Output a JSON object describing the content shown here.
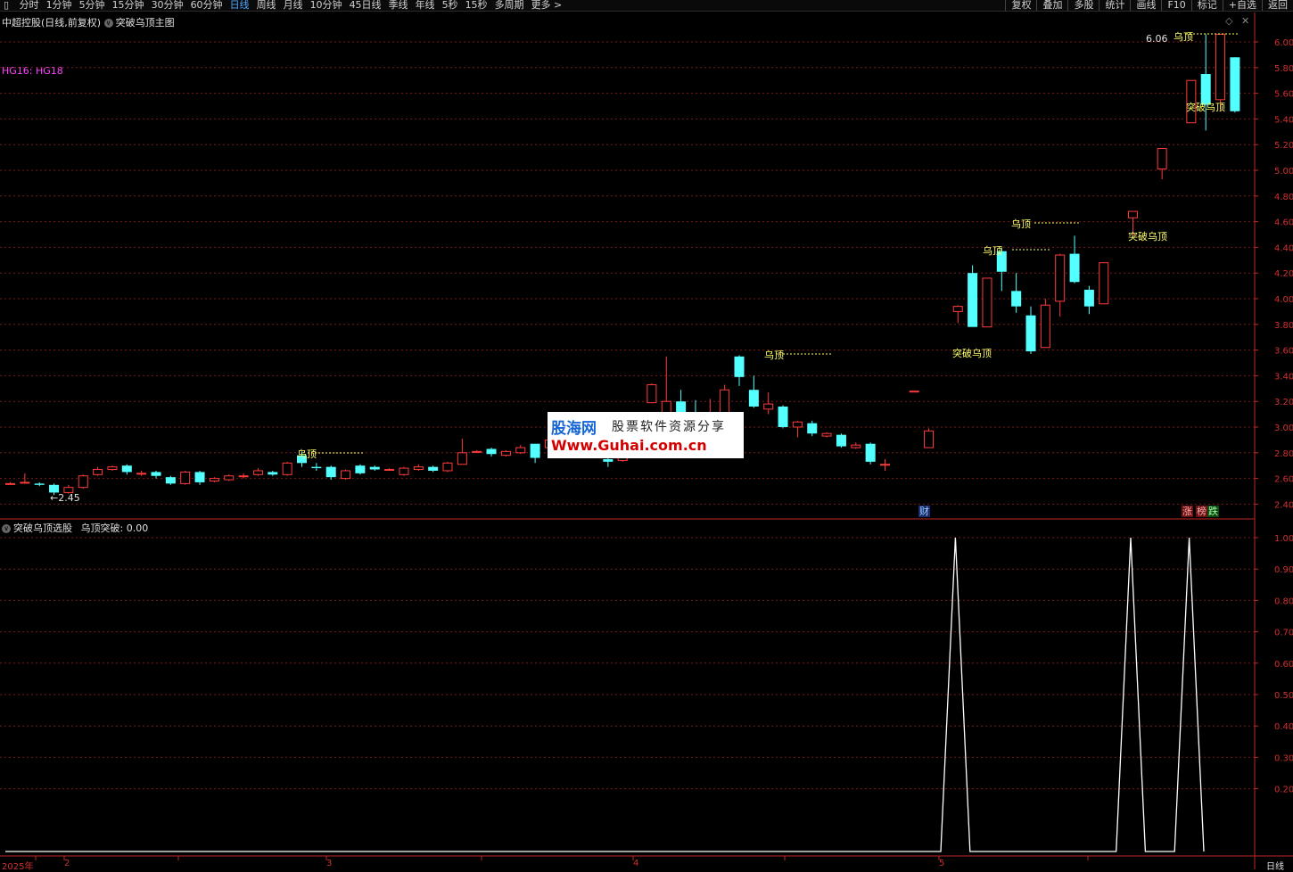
{
  "toolbar": {
    "periods": [
      "分时",
      "1分钟",
      "5分钟",
      "15分钟",
      "30分钟",
      "60分钟",
      "日线",
      "周线",
      "月线",
      "10分钟",
      "45日线",
      "季线",
      "年线",
      "5秒",
      "15秒",
      "多周期",
      "更多 >"
    ],
    "active_index": 6,
    "right": [
      "复权",
      "叠加",
      "多股",
      "统计",
      "画线",
      "F10",
      "标记",
      "+自选",
      "返回"
    ]
  },
  "main_header": {
    "title": "中超控股(日线,前复权)",
    "indicator": "突破乌顶主图",
    "hg": "HG16: HG18"
  },
  "sub_header": {
    "indicator": "突破乌顶选股",
    "value_text": "乌顶突破: 0.00"
  },
  "annotations": {
    "low": "2.45",
    "high": "6.06",
    "wuding": "乌顶",
    "tupo": "突破乌顶",
    "cai": "财",
    "zhang": "涨",
    "bang": "榜",
    "die": "跌"
  },
  "watermark": {
    "logo": "股海网",
    "subtitle": "股票软件资源分享",
    "url": "Www.Guhai.com.cn"
  },
  "bottom_axis": {
    "labels": [
      "2025年",
      "2",
      "3",
      "4",
      "5"
    ],
    "corner": "日线"
  },
  "colors": {
    "up": "#ff3b3b",
    "down": "#54ffff",
    "grid": "#7a1a1a",
    "axis": "#c02828",
    "label_yellow": "#ffff66",
    "magenta": "#ff44ff",
    "active_tab": "#4aa8ff"
  },
  "chart_data": [
    {
      "type": "candlestick",
      "ylim": [
        2.3,
        6.2
      ],
      "y_ticks": [
        6.0,
        5.8,
        5.6,
        5.4,
        5.2,
        5.0,
        4.8,
        4.6,
        4.4,
        4.2,
        4.0,
        3.8,
        3.6,
        3.4,
        3.2,
        3.0,
        2.8,
        2.6,
        2.4
      ],
      "candles": [
        {
          "o": 2.56,
          "h": 2.57,
          "l": 2.55,
          "c": 2.56
        },
        {
          "o": 2.57,
          "h": 2.64,
          "l": 2.56,
          "c": 2.57
        },
        {
          "o": 2.56,
          "h": 2.57,
          "l": 2.54,
          "c": 2.55
        },
        {
          "o": 2.55,
          "h": 2.56,
          "l": 2.47,
          "c": 2.49
        },
        {
          "o": 2.49,
          "h": 2.55,
          "l": 2.48,
          "c": 2.53
        },
        {
          "o": 2.53,
          "h": 2.63,
          "l": 2.52,
          "c": 2.62
        },
        {
          "o": 2.63,
          "h": 2.69,
          "l": 2.62,
          "c": 2.67
        },
        {
          "o": 2.67,
          "h": 2.7,
          "l": 2.66,
          "c": 2.69
        },
        {
          "o": 2.7,
          "h": 2.71,
          "l": 2.63,
          "c": 2.65
        },
        {
          "o": 2.64,
          "h": 2.66,
          "l": 2.62,
          "c": 2.64
        },
        {
          "o": 2.65,
          "h": 2.66,
          "l": 2.6,
          "c": 2.62
        },
        {
          "o": 2.61,
          "h": 2.62,
          "l": 2.55,
          "c": 2.56
        },
        {
          "o": 2.56,
          "h": 2.66,
          "l": 2.55,
          "c": 2.65
        },
        {
          "o": 2.65,
          "h": 2.66,
          "l": 2.55,
          "c": 2.57
        },
        {
          "o": 2.58,
          "h": 2.61,
          "l": 2.57,
          "c": 2.6
        },
        {
          "o": 2.59,
          "h": 2.63,
          "l": 2.58,
          "c": 2.62
        },
        {
          "o": 2.62,
          "h": 2.64,
          "l": 2.6,
          "c": 2.62
        },
        {
          "o": 2.63,
          "h": 2.68,
          "l": 2.62,
          "c": 2.66
        },
        {
          "o": 2.65,
          "h": 2.66,
          "l": 2.62,
          "c": 2.63
        },
        {
          "o": 2.63,
          "h": 2.73,
          "l": 2.62,
          "c": 2.72
        },
        {
          "o": 2.78,
          "h": 2.81,
          "l": 2.69,
          "c": 2.72
        },
        {
          "o": 2.69,
          "h": 2.72,
          "l": 2.66,
          "c": 2.68
        },
        {
          "o": 2.69,
          "h": 2.7,
          "l": 2.59,
          "c": 2.61
        },
        {
          "o": 2.6,
          "h": 2.67,
          "l": 2.59,
          "c": 2.66
        },
        {
          "o": 2.7,
          "h": 2.71,
          "l": 2.63,
          "c": 2.64
        },
        {
          "o": 2.69,
          "h": 2.7,
          "l": 2.66,
          "c": 2.67
        },
        {
          "o": 2.67,
          "h": 2.68,
          "l": 2.66,
          "c": 2.67
        },
        {
          "o": 2.63,
          "h": 2.69,
          "l": 2.62,
          "c": 2.68
        },
        {
          "o": 2.67,
          "h": 2.71,
          "l": 2.66,
          "c": 2.69
        },
        {
          "o": 2.69,
          "h": 2.7,
          "l": 2.65,
          "c": 2.66
        },
        {
          "o": 2.66,
          "h": 2.73,
          "l": 2.65,
          "c": 2.72
        },
        {
          "o": 2.71,
          "h": 2.91,
          "l": 2.71,
          "c": 2.8
        },
        {
          "o": 2.81,
          "h": 2.82,
          "l": 2.8,
          "c": 2.81
        },
        {
          "o": 2.83,
          "h": 2.84,
          "l": 2.77,
          "c": 2.79
        },
        {
          "o": 2.78,
          "h": 2.82,
          "l": 2.77,
          "c": 2.81
        },
        {
          "o": 2.8,
          "h": 2.86,
          "l": 2.79,
          "c": 2.84
        },
        {
          "o": 2.87,
          "h": 2.87,
          "l": 2.72,
          "c": 2.76
        },
        {
          "o": 2.84,
          "h": 2.91,
          "l": 2.83,
          "c": 2.9
        },
        {
          "o": 2.96,
          "h": 3.04,
          "l": 2.94,
          "c": 2.96
        },
        {
          "o": 2.94,
          "h": 2.98,
          "l": 2.88,
          "c": 2.89
        },
        {
          "o": 2.86,
          "h": 2.9,
          "l": 2.84,
          "c": 2.87
        },
        {
          "o": 2.75,
          "h": 2.83,
          "l": 2.69,
          "c": 2.73
        },
        {
          "o": 2.74,
          "h": 2.89,
          "l": 2.73,
          "c": 2.78
        },
        {
          "o": 2.83,
          "h": 2.91,
          "l": 2.81,
          "c": 2.9
        },
        {
          "o": 3.19,
          "h": 3.34,
          "l": 3.19,
          "c": 3.33
        },
        {
          "o": 3.07,
          "h": 3.55,
          "l": 3.05,
          "c": 3.2
        },
        {
          "o": 3.2,
          "h": 3.29,
          "l": 3.12,
          "c": 3.11
        },
        {
          "o": 3.09,
          "h": 3.21,
          "l": 3.04,
          "c": 3.08
        },
        {
          "o": 3.09,
          "h": 3.22,
          "l": 3.06,
          "c": 3.11
        },
        {
          "o": 3.01,
          "h": 3.33,
          "l": 3.0,
          "c": 3.29
        },
        {
          "o": 3.55,
          "h": 3.56,
          "l": 3.32,
          "c": 3.39
        },
        {
          "o": 3.29,
          "h": 3.4,
          "l": 3.15,
          "c": 3.16
        },
        {
          "o": 3.14,
          "h": 3.27,
          "l": 3.1,
          "c": 3.18
        },
        {
          "o": 3.16,
          "h": 3.17,
          "l": 2.99,
          "c": 3.0
        },
        {
          "o": 3.0,
          "h": 3.05,
          "l": 2.92,
          "c": 3.04
        },
        {
          "o": 3.03,
          "h": 3.05,
          "l": 2.93,
          "c": 2.95
        },
        {
          "o": 2.93,
          "h": 2.96,
          "l": 2.92,
          "c": 2.95
        },
        {
          "o": 2.94,
          "h": 2.95,
          "l": 2.84,
          "c": 2.85
        },
        {
          "o": 2.84,
          "h": 2.88,
          "l": 2.83,
          "c": 2.86
        },
        {
          "o": 2.87,
          "h": 2.88,
          "l": 2.71,
          "c": 2.73
        },
        {
          "o": 2.71,
          "h": 2.75,
          "l": 2.66,
          "c": 2.71
        },
        null,
        {
          "o": 3.28,
          "h": 3.28,
          "l": 3.28,
          "c": 3.28
        },
        {
          "o": 2.84,
          "h": 2.99,
          "l": 2.84,
          "c": 2.97
        },
        null,
        {
          "o": 3.9,
          "h": 3.95,
          "l": 3.81,
          "c": 3.94
        },
        {
          "o": 4.2,
          "h": 4.26,
          "l": 3.78,
          "c": 3.78
        },
        {
          "o": 3.78,
          "h": 4.16,
          "l": 3.78,
          "c": 4.16
        },
        {
          "o": 4.37,
          "h": 4.4,
          "l": 4.06,
          "c": 4.21
        },
        {
          "o": 4.06,
          "h": 4.2,
          "l": 3.89,
          "c": 3.94
        },
        {
          "o": 3.87,
          "h": 3.94,
          "l": 3.57,
          "c": 3.59
        },
        {
          "o": 3.62,
          "h": 4.0,
          "l": 3.62,
          "c": 3.95
        },
        {
          "o": 3.98,
          "h": 4.35,
          "l": 3.86,
          "c": 4.34
        },
        {
          "o": 4.35,
          "h": 4.49,
          "l": 4.12,
          "c": 4.13
        },
        {
          "o": 4.07,
          "h": 4.1,
          "l": 3.88,
          "c": 3.94
        },
        {
          "o": 3.96,
          "h": 4.28,
          "l": 3.96,
          "c": 4.28
        },
        null,
        {
          "o": 4.63,
          "h": 4.68,
          "l": 4.48,
          "c": 4.68
        },
        null,
        {
          "o": 5.01,
          "h": 5.17,
          "l": 4.93,
          "c": 5.17
        },
        null,
        {
          "o": 5.37,
          "h": 5.7,
          "l": 5.37,
          "c": 5.7
        },
        {
          "o": 5.75,
          "h": 6.06,
          "l": 5.31,
          "c": 5.51
        },
        {
          "o": 5.55,
          "h": 6.06,
          "l": 5.46,
          "c": 6.06
        },
        {
          "o": 5.88,
          "h": 5.88,
          "l": 5.45,
          "c": 5.46
        }
      ]
    },
    {
      "type": "line",
      "name": "乌顶突破",
      "ylim": [
        0,
        1.05
      ],
      "y_ticks": [
        1.0,
        0.9,
        0.8,
        0.7,
        0.6,
        0.5,
        0.4,
        0.3,
        0.2
      ],
      "values": [
        0,
        0,
        0,
        0,
        0,
        0,
        0,
        0,
        0,
        0,
        0,
        0,
        0,
        0,
        0,
        0,
        0,
        0,
        0,
        0,
        0,
        0,
        0,
        0,
        0,
        0,
        0,
        0,
        0,
        0,
        0,
        0,
        0,
        0,
        0,
        0,
        0,
        0,
        0,
        0,
        0,
        0,
        0,
        0,
        0,
        0,
        0,
        0,
        0,
        0,
        0,
        0,
        0,
        0,
        0,
        0,
        0,
        0,
        0,
        0,
        0,
        0,
        0,
        0,
        0,
        1,
        0,
        0,
        0,
        0,
        0,
        0,
        0,
        0,
        0,
        0,
        0,
        1,
        0,
        0,
        0,
        1,
        0
      ]
    }
  ]
}
